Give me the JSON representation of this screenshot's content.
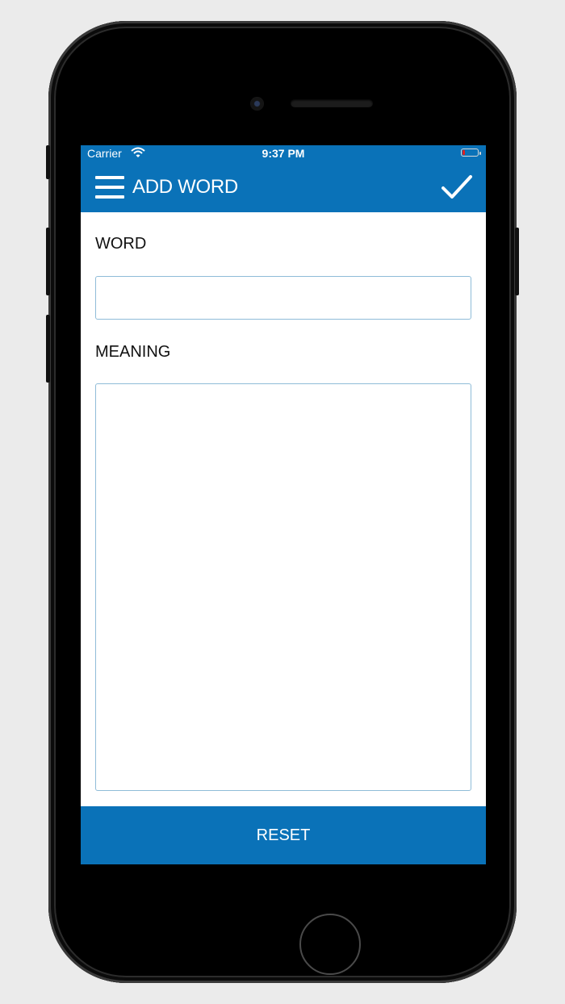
{
  "status_bar": {
    "carrier": "Carrier",
    "time": "9:37 PM",
    "battery_level": 0.15,
    "wifi_icon": "wifi-icon",
    "battery_color": "#e02020"
  },
  "nav_bar": {
    "title": "ADD WORD",
    "menu_icon": "hamburger-menu-icon",
    "confirm_icon": "checkmark-icon",
    "background": "#0a72b8"
  },
  "form": {
    "word_label": "WORD",
    "word_value": "",
    "meaning_label": "MEANING",
    "meaning_value": ""
  },
  "footer": {
    "reset_label": "RESET"
  }
}
